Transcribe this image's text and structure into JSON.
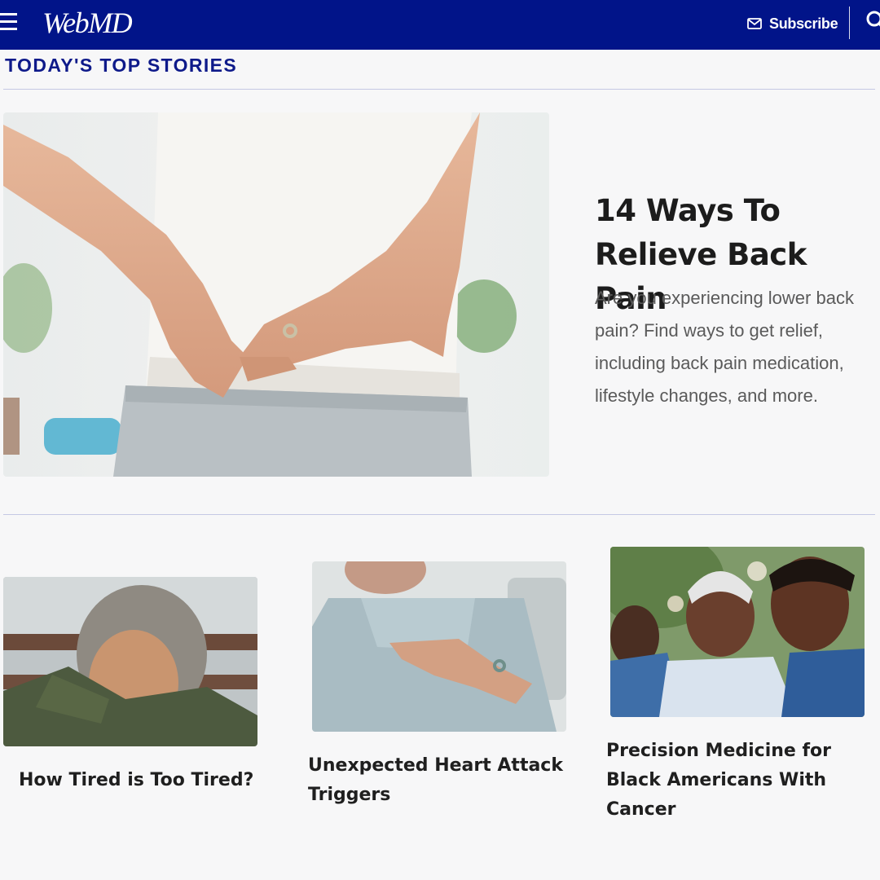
{
  "header": {
    "logo": "WebMD",
    "subscribe_label": "Subscribe",
    "background_color": "#011489"
  },
  "section": {
    "title": "TODAY'S TOP STORIES"
  },
  "featured": {
    "title": "14 Ways To Relieve Back Pain",
    "description": "Are you experiencing lower back pain? Find ways to get relief, including back pain medication, lifestyle changes, and more."
  },
  "stories": [
    {
      "title": "How Tired is Too Tired?"
    },
    {
      "title": "Unexpected Heart Attack Triggers"
    },
    {
      "title": "Precision Medicine for Black Americans With Cancer"
    }
  ]
}
